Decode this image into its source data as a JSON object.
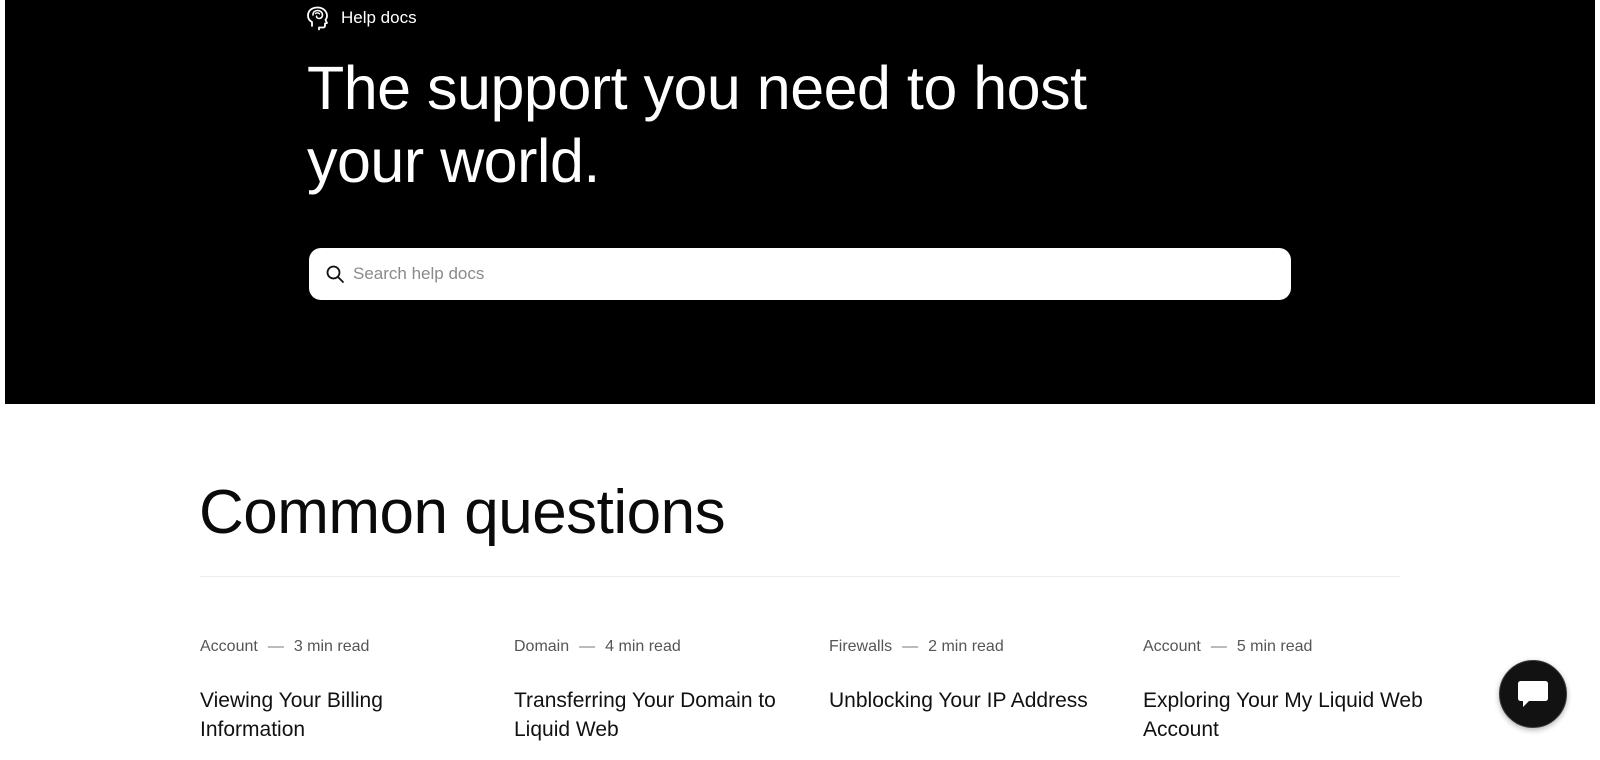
{
  "header": {
    "brand_label": "Help docs"
  },
  "hero": {
    "title": "The support you need to host your world."
  },
  "search": {
    "placeholder": "Search help docs",
    "value": ""
  },
  "section": {
    "title": "Common questions"
  },
  "questions": [
    {
      "category": "Account",
      "separator": "—",
      "read_time": "3 min read",
      "title": "Viewing Your Billing Information"
    },
    {
      "category": "Domain",
      "separator": "—",
      "read_time": "4 min read",
      "title": "Transferring Your Domain to Liquid Web"
    },
    {
      "category": "Firewalls",
      "separator": "—",
      "read_time": "2 min read",
      "title": "Unblocking Your IP Address"
    },
    {
      "category": "Account",
      "separator": "—",
      "read_time": "5 min read",
      "title": "Exploring Your My Liquid Web Account"
    }
  ],
  "colors": {
    "hero_background": "#000000",
    "page_background": "#ffffff",
    "chat_button": "#121212"
  },
  "icons": {
    "brand": "brain-head-icon",
    "search": "search-icon",
    "chat": "chat-bubble-icon"
  }
}
